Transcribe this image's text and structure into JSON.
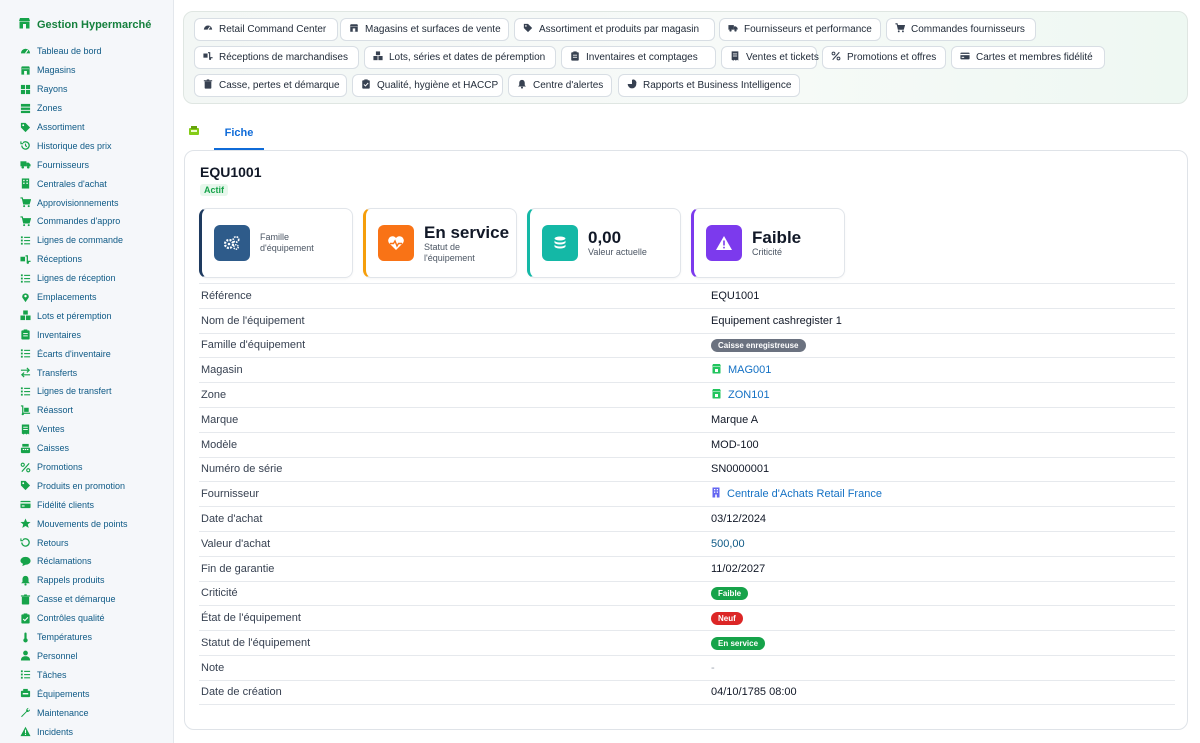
{
  "brand": {
    "title": "Gestion Hypermarché",
    "color": "#16a34a"
  },
  "sidebar": {
    "items": [
      {
        "label": "Tableau de bord",
        "icon": "dashboard-icon"
      },
      {
        "label": "Magasins",
        "icon": "store-icon"
      },
      {
        "label": "Rayons",
        "icon": "grid-icon"
      },
      {
        "label": "Zones",
        "icon": "layers-icon"
      },
      {
        "label": "Assortiment",
        "icon": "tag-icon"
      },
      {
        "label": "Historique des prix",
        "icon": "history-icon"
      },
      {
        "label": "Fournisseurs",
        "icon": "truck-icon"
      },
      {
        "label": "Centrales d'achat",
        "icon": "building-icon"
      },
      {
        "label": "Approvisionnements",
        "icon": "cart-icon"
      },
      {
        "label": "Commandes d'appro",
        "icon": "cart-icon"
      },
      {
        "label": "Lignes de commande",
        "icon": "list-icon"
      },
      {
        "label": "Réceptions",
        "icon": "truck-loading-icon"
      },
      {
        "label": "Lignes de réception",
        "icon": "list-icon"
      },
      {
        "label": "Emplacements",
        "icon": "map-pin-icon"
      },
      {
        "label": "Lots et péremption",
        "icon": "boxes-icon"
      },
      {
        "label": "Inventaires",
        "icon": "clipboard-icon"
      },
      {
        "label": "Écarts d'inventaire",
        "icon": "list-icon"
      },
      {
        "label": "Transferts",
        "icon": "exchange-icon"
      },
      {
        "label": "Lignes de transfert",
        "icon": "list-icon"
      },
      {
        "label": "Réassort",
        "icon": "dolly-icon"
      },
      {
        "label": "Ventes",
        "icon": "receipt-icon"
      },
      {
        "label": "Caisses",
        "icon": "cash-register-icon"
      },
      {
        "label": "Promotions",
        "icon": "percent-icon"
      },
      {
        "label": "Produits en promotion",
        "icon": "tag-icon"
      },
      {
        "label": "Fidélité clients",
        "icon": "card-icon"
      },
      {
        "label": "Mouvements de points",
        "icon": "star-icon"
      },
      {
        "label": "Retours",
        "icon": "undo-icon"
      },
      {
        "label": "Réclamations",
        "icon": "comment-icon"
      },
      {
        "label": "Rappels produits",
        "icon": "bell-icon"
      },
      {
        "label": "Casse et démarque",
        "icon": "trash-icon"
      },
      {
        "label": "Contrôles qualité",
        "icon": "check-clipboard-icon"
      },
      {
        "label": "Températures",
        "icon": "thermometer-icon"
      },
      {
        "label": "Personnel",
        "icon": "user-icon"
      },
      {
        "label": "Tâches",
        "icon": "tasks-icon"
      },
      {
        "label": "Équipements",
        "icon": "equipment-icon"
      },
      {
        "label": "Maintenance",
        "icon": "wrench-icon"
      },
      {
        "label": "Incidents",
        "icon": "warning-icon"
      }
    ]
  },
  "topnav": {
    "chips": [
      {
        "label": "Retail Command Center",
        "icon": "gauge-icon"
      },
      {
        "label": "Magasins et surfaces de vente",
        "icon": "store-icon"
      },
      {
        "label": "Assortiment et produits par magasin",
        "icon": "tags-icon"
      },
      {
        "label": "Fournisseurs et performance",
        "icon": "truck-icon"
      },
      {
        "label": "Commandes fournisseurs",
        "icon": "cart-icon"
      },
      {
        "label": "Réceptions de marchandises",
        "icon": "truck-loading-icon"
      },
      {
        "label": "Lots, séries et dates de péremption",
        "icon": "boxes-icon"
      },
      {
        "label": "Inventaires et comptages",
        "icon": "clipboard-icon"
      },
      {
        "label": "Ventes et tickets",
        "icon": "receipt-icon"
      },
      {
        "label": "Promotions et offres",
        "icon": "percent-icon"
      },
      {
        "label": "Cartes et membres fidélité",
        "icon": "card-icon"
      },
      {
        "label": "Casse, pertes et démarque",
        "icon": "trash-icon"
      },
      {
        "label": "Qualité, hygiène et HACCP",
        "icon": "check-clipboard-icon"
      },
      {
        "label": "Centre d'alertes",
        "icon": "bell-icon"
      },
      {
        "label": "Rapports et Business Intelligence",
        "icon": "chart-pie-icon"
      }
    ]
  },
  "tabs": {
    "icon": "equipment-icon",
    "active": "Fiche"
  },
  "record": {
    "code": "EQU1001",
    "state": "Actif",
    "kpis": [
      {
        "big": "",
        "small": "Famille d'équipement",
        "icon": "cogs-icon",
        "color": "#2e5b8a",
        "border": "#1e3a5f"
      },
      {
        "big": "En service",
        "small": "Statut de l'équipement",
        "icon": "heartbeat-icon",
        "color": "#f97316",
        "border": "#f59e0b"
      },
      {
        "big": "0,00",
        "small": "Valeur actuelle",
        "icon": "coins-icon",
        "color": "#14b8a6",
        "border": "#14b8a6"
      },
      {
        "big": "Faible",
        "small": "Criticité",
        "icon": "warning-icon",
        "color": "#7c3aed",
        "border": "#7c3aed"
      }
    ],
    "fields": {
      "ref": {
        "label": "Référence",
        "value": "EQU1001"
      },
      "name": {
        "label": "Nom de l'équipement",
        "value": "Equipement cashregister 1"
      },
      "family": {
        "label": "Famille d'équipement",
        "value": "Caisse enregistreuse",
        "color": "#6b7280"
      },
      "store": {
        "label": "Magasin",
        "value": "MAG001",
        "icon": "store-icon"
      },
      "zone": {
        "label": "Zone",
        "value": "ZON101",
        "icon": "store-icon"
      },
      "brand": {
        "label": "Marque",
        "value": "Marque A"
      },
      "model": {
        "label": "Modèle",
        "value": "MOD-100"
      },
      "serial": {
        "label": "Numéro de série",
        "value": "SN0000001"
      },
      "supplier": {
        "label": "Fournisseur",
        "value": "Centrale d'Achats Retail France",
        "icon": "building-icon"
      },
      "purchase_date": {
        "label": "Date d'achat",
        "value": "03/12/2024"
      },
      "purchase_value": {
        "label": "Valeur d'achat",
        "value": "500,00"
      },
      "warranty_end": {
        "label": "Fin de garantie",
        "value": "11/02/2027"
      },
      "criticality": {
        "label": "Criticité",
        "value": "Faible",
        "color": "#16a34a"
      },
      "condition": {
        "label": "État de l'équipement",
        "value": "Neuf",
        "color": "#dc2626"
      },
      "status": {
        "label": "Statut de l'équipement",
        "value": "En service",
        "color": "#16a34a"
      },
      "note": {
        "label": "Note",
        "value": "-"
      },
      "created": {
        "label": "Date de création",
        "value": "04/10/1785 08:00"
      }
    }
  }
}
